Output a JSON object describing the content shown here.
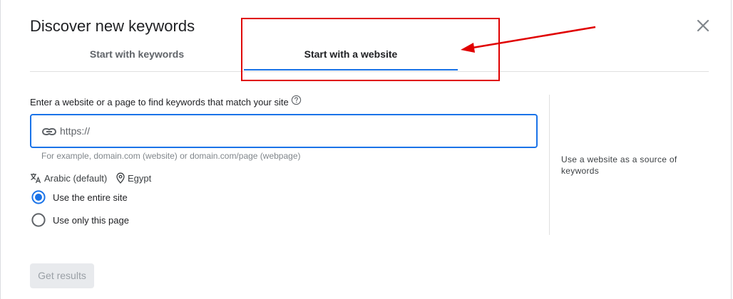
{
  "dialog": {
    "title": "Discover new keywords",
    "close_icon": "close-icon"
  },
  "tabs": [
    {
      "label": "Start with keywords",
      "selected": false
    },
    {
      "label": "Start with a website",
      "selected": true
    }
  ],
  "form": {
    "label": "Enter a website or a page to find keywords that match your site",
    "help_icon": "help-circle-icon",
    "input_placeholder": "https://",
    "input_value": "",
    "link_icon": "link-icon",
    "hint": "For example, domain.com (website) or domain.com/page (webpage)",
    "language": "Arabic (default)",
    "language_icon": "translate-icon",
    "location": "Egypt",
    "location_icon": "location-pin-icon",
    "options": [
      {
        "label": "Use the entire site",
        "selected": true
      },
      {
        "label": "Use only this page",
        "selected": false
      }
    ],
    "submit_label": "Get results",
    "submit_disabled": true
  },
  "side_panel": {
    "text": "Use a website as a source of keywords"
  },
  "colors": {
    "accent": "#1a73e8",
    "annotation": "#e00000",
    "disabled_bg": "#e8eaed",
    "disabled_text": "#9aa0a6"
  }
}
